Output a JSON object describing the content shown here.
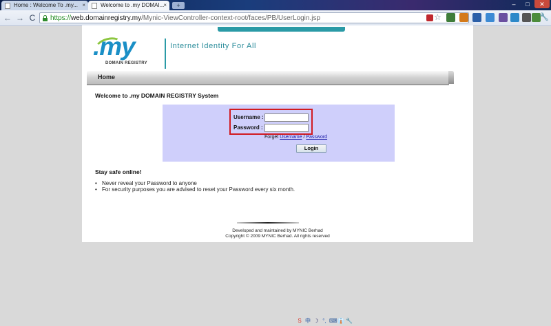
{
  "browser": {
    "tabs": [
      {
        "title": "Home : Welcome To .my..."
      },
      {
        "title": "Welcome to .my DOMAI..."
      }
    ],
    "tab_close_glyph": "×",
    "new_tab_glyph": "+",
    "window_controls": {
      "minimize": "–",
      "maximize": "□",
      "close": "✕"
    },
    "nav": {
      "back": "←",
      "forward": "→",
      "reload": "C"
    },
    "url": {
      "scheme": "https://",
      "host": "web.domainregistry.my",
      "path": "/Mynic-ViewController-context-root/faces/PB/UserLogin.jsp"
    },
    "bookmark_star": "☆",
    "menu_wrench": "🔧",
    "extension_icon_colors": [
      "#c0282e",
      "#3f7d3a",
      "#d47a1a",
      "#2b5fa8",
      "#3c8ad4",
      "#6a4fa0",
      "#2d89c9",
      "#555555",
      "#4c8c3b"
    ]
  },
  "site": {
    "logo_text": ".my",
    "logo_subtitle": "DOMAIN REGISTRY",
    "tagline": "Internet Identity For All",
    "nav_home": "Home",
    "welcome": "Welcome to .my DOMAIN REGISTRY System",
    "login": {
      "username_label": "Username :",
      "password_label": "Password :",
      "username_value": "",
      "password_value": "",
      "forgot_prefix": "Forget",
      "forgot_username": "Username",
      "forgot_sep": "/",
      "forgot_password": "Password",
      "button": "Login"
    },
    "safe_title": "Stay safe online!",
    "tips": [
      "Never reveal your Password to anyone",
      "For security purposes you are advised to reset your Password every six month."
    ],
    "footer": [
      "Developed and maintained by MYNIC Berhad",
      "Copyright © 2009 MYNIC Berhad. All rights reserved"
    ],
    "colors": {
      "accent": "#2a9aa6",
      "login_panel": "#cfcffb",
      "highlight": "#d11a20",
      "logo_blue": "#1a8fc6",
      "logo_green": "#8cc63f"
    }
  },
  "tray": {
    "items": [
      "S",
      "中",
      "☽",
      "°,",
      "⌨",
      "👔",
      "🔧"
    ]
  }
}
